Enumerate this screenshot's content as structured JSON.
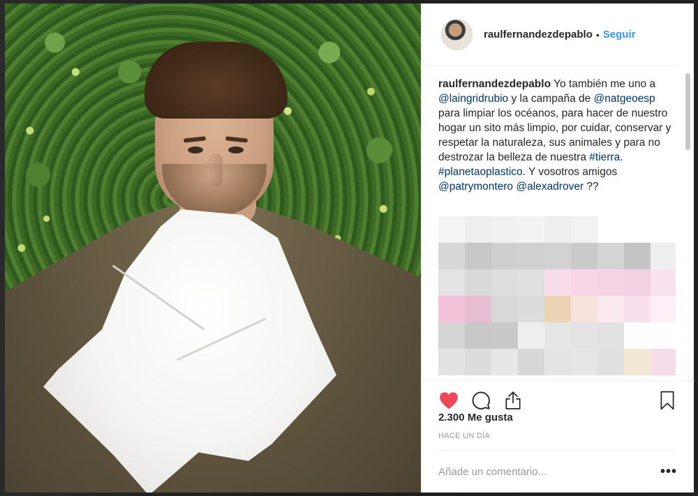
{
  "post": {
    "username": "raulfernandezdepablo",
    "separator": "•",
    "follow_label": "Seguir"
  },
  "caption": {
    "author": "raulfernandezdepablo",
    "text_1": " Yo también me uno a ",
    "mention_1": "@laingridrubio",
    "text_2": " y la campaña de ",
    "mention_2": "@natgeoesp",
    "text_3": " para limpiar los océanos, para hacer de nuestro hogar un sito más limpio, por cuidar, conservar y respetar la naturaleza, sus animales y para no destrozar la belleza de nuestra ",
    "hashtag_1": "#tierra",
    "text_4": ". ",
    "hashtag_2": "#planetaoplastico",
    "text_5": ". Y vosotros amigos ",
    "mention_3": "@patrymontero",
    "text_6": " ",
    "mention_4": "@alexadrover",
    "text_7": " ??"
  },
  "pixelated_comments": {
    "colors": [
      "#f4f4f4",
      "#eeeeee",
      "#f1f1f1",
      "#f3f3f3",
      "#eeeeee",
      "#f2f2f2",
      "#ffffff",
      "#ffffff",
      "#ffffff",
      "#d8d8d8",
      "#c8c8c8",
      "#cfcfcf",
      "#d0d0d0",
      "#d2d2d2",
      "#cacaca",
      "#d4d4d4",
      "#c4c4c4",
      "#efefef",
      "#e3e3e3",
      "#d9d9d9",
      "#dedede",
      "#e0e0e0",
      "#f6dbe8",
      "#f7d5e6",
      "#f5d3e4",
      "#f2d2e2",
      "#f9e2ee",
      "#f2c3d8",
      "#e7bed0",
      "#d9d9d9",
      "#dcdcdc",
      "#ecd5b5",
      "#f8e2dc",
      "#fbe9f0",
      "#f8e1ec",
      "#fdeff5",
      "#d5d5d5",
      "#c8c8c8",
      "#c9c9c9",
      "#eeeeee",
      "#e6e6e6",
      "#e3e3e3",
      "#e1e1e1",
      "#ffffff",
      "#ffffff",
      "#e2e2e2",
      "#dcdcdc",
      "#e7e7e7",
      "#d7d7d7",
      "#e4e4e4",
      "#e5e5e5",
      "#e0e0e0",
      "#f3e8d6",
      "#f6dbe8"
    ]
  },
  "actions": {
    "like_icon": "heart-filled-icon",
    "comment_icon": "comment-bubble-icon",
    "share_icon": "share-icon",
    "save_icon": "bookmark-icon",
    "like_color": "#ed4956"
  },
  "likes_text": "2.300 Me gusta",
  "timestamp": "HACE UN DÍA",
  "comment_box": {
    "placeholder": "Añade un comentario...",
    "more_label": "•••"
  }
}
